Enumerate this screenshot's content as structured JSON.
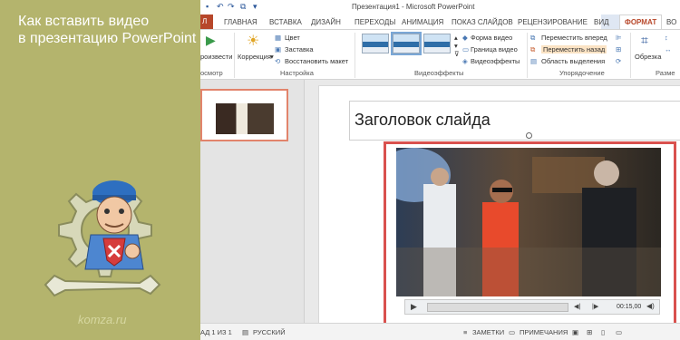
{
  "promo": {
    "title_line1": "Как вставить видео",
    "title_line2": "в презентацию PowerPoint",
    "site": "komza.ru",
    "background": "#b4b46d"
  },
  "window": {
    "title": "Презентация1 - Microsoft PowerPoint"
  },
  "quick_access": [
    "save-icon",
    "undo-icon",
    "redo-icon",
    "start-icon"
  ],
  "tabs": {
    "file": "Л",
    "items": [
      "ГЛАВНАЯ",
      "ВСТАВКА",
      "ДИЗАЙН",
      "ПЕРЕХОДЫ",
      "АНИМАЦИЯ",
      "ПОКАЗ СЛАЙДОВ",
      "РЕЦЕНЗИРОВАНИЕ",
      "ВИД"
    ],
    "format": "ФОРМАТ",
    "cutoff": "ВО"
  },
  "ribbon": {
    "preview": {
      "label": "роизвести",
      "group": "осмотр"
    },
    "adjust": {
      "correction": "Коррекция",
      "color": "Цвет",
      "poster": "Заставка",
      "reset": "Восстановить макет",
      "group": "Настройка"
    },
    "video_styles": {
      "shape": "Форма видео",
      "border": "Граница видео",
      "effects": "Видеоэффекты",
      "group": "Видеоэффекты"
    },
    "arrange": {
      "forward": "Переместить вперед",
      "backward": "Переместить назад",
      "selection": "Область выделения",
      "group": "Упорядочение"
    },
    "size": {
      "crop": "Обрезка",
      "group": "Разме"
    }
  },
  "slide": {
    "title": "Заголовок слайда",
    "video_duration": "00:15,00",
    "progress": 0
  },
  "statusbar": {
    "slide": "АД 1 ИЗ 1",
    "language": "РУССКИЙ",
    "notes": "ЗАМЕТКИ",
    "comments": "ПРИМЕЧАНИЯ"
  },
  "colors": {
    "accent": "#b7472a",
    "selection_frame": "#d9514e",
    "ribbon_blue": "#2b579a"
  }
}
